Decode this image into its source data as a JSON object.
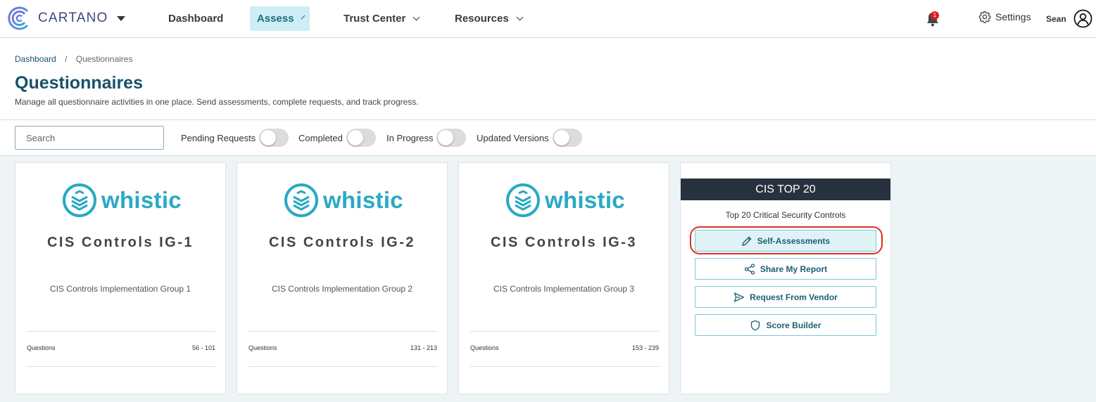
{
  "brand": {
    "name": "CARTANO"
  },
  "nav": {
    "items": [
      {
        "label": "Dashboard"
      },
      {
        "label": "Assess"
      },
      {
        "label": "Trust Center"
      },
      {
        "label": "Resources"
      }
    ],
    "notification_count": "1",
    "settings_label": "Settings",
    "user_name": "Sean"
  },
  "breadcrumb": {
    "home": "Dashboard",
    "current": "Questionnaires"
  },
  "page": {
    "title": "Questionnaires",
    "subtitle": "Manage all questionnaire activities in one place. Send assessments, complete requests, and track progress."
  },
  "filters": {
    "search_placeholder": "Search",
    "toggles": [
      {
        "label": "Pending Requests",
        "on": false
      },
      {
        "label": "Completed",
        "on": false
      },
      {
        "label": "In Progress",
        "on": false
      },
      {
        "label": "Updated Versions",
        "on": false
      }
    ]
  },
  "cards": [
    {
      "logo_text": "whistic",
      "title": "CIS Controls IG-1",
      "description": "CIS Controls Implementation Group 1",
      "questions_label": "Questions",
      "questions_range": "56 - 101"
    },
    {
      "logo_text": "whistic",
      "title": "CIS Controls IG-2",
      "description": "CIS Controls Implementation Group 2",
      "questions_label": "Questions",
      "questions_range": "131 - 213"
    },
    {
      "logo_text": "whistic",
      "title": "CIS Controls IG-3",
      "description": "CIS Controls Implementation Group 3",
      "questions_label": "Questions",
      "questions_range": "153 - 239"
    }
  ],
  "cis_top": {
    "header": "CIS TOP 20",
    "subtitle": "Top 20 Critical Security Controls",
    "buttons": [
      {
        "label": "Self-Assessments",
        "icon": "pencil-icon"
      },
      {
        "label": "Share My Report",
        "icon": "share-icon"
      },
      {
        "label": "Request From Vendor",
        "icon": "send-icon"
      },
      {
        "label": "Score Builder",
        "icon": "shield-icon"
      }
    ]
  },
  "colors": {
    "accent": "#17526b",
    "active_nav_bg": "#cdeef4",
    "whistic": "#29a9c4",
    "cis_header": "#28323e",
    "highlight": "#d93025"
  }
}
